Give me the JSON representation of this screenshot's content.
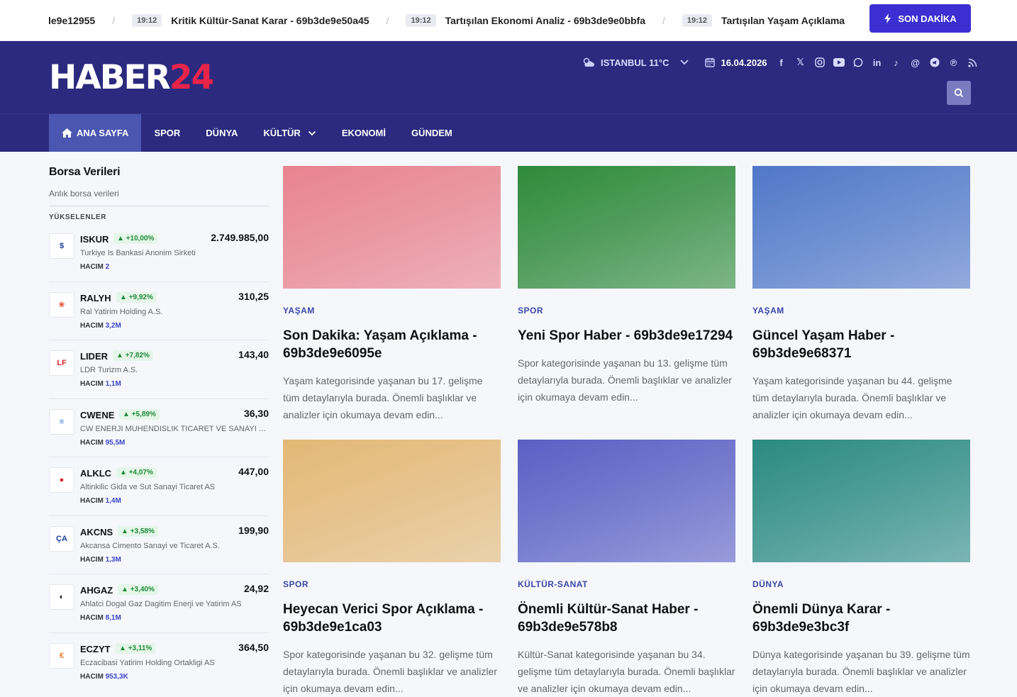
{
  "ticker": {
    "items": [
      {
        "time": "",
        "text": "le9e12955"
      },
      {
        "time": "19:12",
        "text": "Kritik Kültür-Sanat Karar - 69b3de9e50a45"
      },
      {
        "time": "19:12",
        "text": "Tartışılan Ekonomi Analiz - 69b3de9e0bbfa"
      },
      {
        "time": "19:12",
        "text": "Tartışılan Yaşam Açıklama"
      }
    ],
    "son_dakika": "SON DAKİKA"
  },
  "header": {
    "logo_a": "HABER",
    "logo_b": "24",
    "weather": "ISTANBUL 11°C",
    "date": "16.04.2026",
    "social_icons": [
      "facebook-icon",
      "x-icon",
      "instagram-icon",
      "youtube-icon",
      "whatsapp-icon",
      "linkedin-icon",
      "tiktok-icon",
      "threads-icon",
      "telegram-icon",
      "pinterest-icon",
      "rss-icon"
    ]
  },
  "nav": {
    "items": [
      "ANA SAYFA",
      "SPOR",
      "DÜNYA",
      "KÜLTÜR",
      "EKONOMİ",
      "GÜNDEM"
    ]
  },
  "borsa": {
    "title": "Borsa Verileri",
    "subtitle": "Anlık borsa verileri",
    "section": "YÜKSELENLER",
    "hacim_label": "HACIM",
    "stocks": [
      {
        "sym": "ISKUR",
        "change": "+10,00%",
        "price": "2.749.985,00",
        "name": "Turkiye Is Bankasi Anonim Sirketi",
        "hacim": "2",
        "logo": "$",
        "color": "#1d3f9a"
      },
      {
        "sym": "RALYH",
        "change": "+9,92%",
        "price": "310,25",
        "name": "Ral Yatirim Holding A.S.",
        "hacim": "3,2M",
        "logo": "❀",
        "color": "#e2452b"
      },
      {
        "sym": "LIDER",
        "change": "+7,82%",
        "price": "143,40",
        "name": "LDR Turizm A.S.",
        "hacim": "1,1M",
        "logo": "LF",
        "color": "#d8262d"
      },
      {
        "sym": "CWENE",
        "change": "+5,89%",
        "price": "36,30",
        "name": "CW ENERJI MUHENDISLIK TICARET VE SANAYI ANONIM SIRKETI",
        "hacim": "95,5M",
        "logo": "≡",
        "color": "#2b71c8"
      },
      {
        "sym": "ALKLC",
        "change": "+4,07%",
        "price": "447,00",
        "name": "Altinkilic Gida ve Sut Sanayi Ticaret AS",
        "hacim": "1,4M",
        "logo": "●",
        "color": "#d8262d"
      },
      {
        "sym": "AKCNS",
        "change": "+3,58%",
        "price": "199,90",
        "name": "Akcansa Cimento Sanayi ve Ticaret A.S.",
        "hacim": "1,3M",
        "logo": "ÇA",
        "color": "#1d3f9a"
      },
      {
        "sym": "AHGAZ",
        "change": "+3,40%",
        "price": "24,92",
        "name": "Ahlatci Dogal Gaz Dagitim Enerji ve Yatirim AS",
        "hacim": "8,1M",
        "logo": "◐",
        "color": "#111"
      },
      {
        "sym": "ECZYT",
        "change": "+3,11%",
        "price": "364,50",
        "name": "Eczacibasi Yatirim Holding Ortakligi AS",
        "hacim": "953,3K",
        "logo": "€",
        "color": "#e07a2a"
      }
    ]
  },
  "articles": [
    {
      "cat": "YAŞAM",
      "title": "Son Dakika: Yaşam Açıklama - 69b3de9e6095e",
      "desc": "Yaşam kategorisinde yaşanan bu 17. gelişme tüm detaylarıyla burada. Önemli başlıklar ve analizler için okumaya devam edin...",
      "tint": "#e8838f"
    },
    {
      "cat": "SPOR",
      "title": "Yeni Spor Haber - 69b3de9e17294",
      "desc": "Spor kategorisinde yaşanan bu 13. gelişme tüm detaylarıyla burada. Önemli başlıklar ve analizler için okumaya devam edin...",
      "tint": "#2e8a3a"
    },
    {
      "cat": "YAŞAM",
      "title": "Güncel Yaşam Haber - 69b3de9e68371",
      "desc": "Yaşam kategorisinde yaşanan bu 44. gelişme tüm detaylarıyla burada. Önemli başlıklar ve analizler için okumaya devam edin...",
      "tint": "#5078c8"
    },
    {
      "cat": "SPOR",
      "title": "Heyecan Verici Spor Açıklama - 69b3de9e1ca03",
      "desc": "Spor kategorisinde yaşanan bu 32. gelişme tüm detaylarıyla burada. Önemli başlıklar ve analizler için okumaya devam edin...",
      "tint": "#e3b876"
    },
    {
      "cat": "KÜLTÜR-SANAT",
      "title": "Önemli Kültür-Sanat Haber - 69b3de9e578b8",
      "desc": "Kültür-Sanat kategorisinde yaşanan bu 34. gelişme tüm detaylarıyla burada. Önemli başlıklar ve analizler için okumaya devam edin...",
      "tint": "#5a5fc4"
    },
    {
      "cat": "DÜNYA",
      "title": "Önemli Dünya Karar - 69b3de9e3bc3f",
      "desc": "Dünya kategorisinde yaşanan bu 39. gelişme tüm detaylarıyla burada. Önemli başlıklar ve analizler için okumaya devam edin...",
      "tint": "#2a8a82"
    }
  ]
}
